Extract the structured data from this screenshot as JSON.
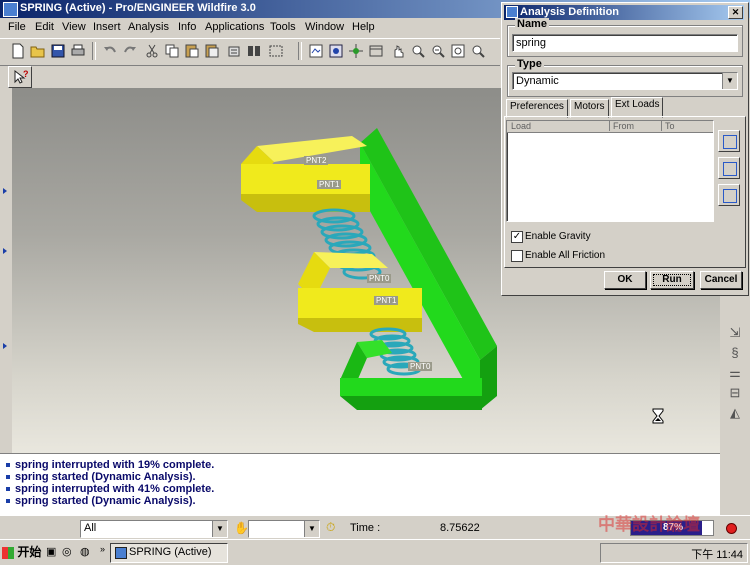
{
  "window": {
    "title": "SPRING (Active) - Pro/ENGINEER Wildfire 3.0"
  },
  "menubar": [
    "File",
    "Edit",
    "View",
    "Insert",
    "Analysis",
    "Info",
    "Applications",
    "Tools",
    "Window",
    "Help"
  ],
  "model_labels": [
    "PNT2",
    "PNT1",
    "PNT0",
    "PNT1",
    "PNT0"
  ],
  "messages": [
    "spring interrupted with 19% complete.",
    "spring started (Dynamic Analysis).",
    "spring interrupted with 41% complete.",
    "spring started (Dynamic Analysis)."
  ],
  "statusbar": {
    "filter_value": "All",
    "time_label": "Time :",
    "time_value": "8.75622",
    "progress": "87%",
    "progress_fraction": 0.87
  },
  "taskbar": {
    "start_label": "开始",
    "task_label": "SPRING (Active)",
    "clock": "下午 11:44"
  },
  "watermark": {
    "line1": "中華設計論壇",
    "line2": "bbs.chinade.net"
  },
  "dialog": {
    "title": "Analysis Definition",
    "name_label": "Name",
    "name_value": "spring",
    "type_label": "Type",
    "type_value": "Dynamic",
    "tabs": [
      "Preferences",
      "Motors",
      "Ext Loads"
    ],
    "active_tab": "Ext Loads",
    "table_headers": [
      "Load",
      "From",
      "To"
    ],
    "enable_gravity_label": "Enable Gravity",
    "enable_gravity_checked": true,
    "enable_friction_label": "Enable All Friction",
    "enable_friction_checked": false,
    "ok_label": "OK",
    "run_label": "Run",
    "cancel_label": "Cancel"
  },
  "colors": {
    "yellow": "#f0ea1c",
    "green": "#22d91c",
    "spring": "#38b6c8",
    "titlebar": "#0a246a"
  }
}
